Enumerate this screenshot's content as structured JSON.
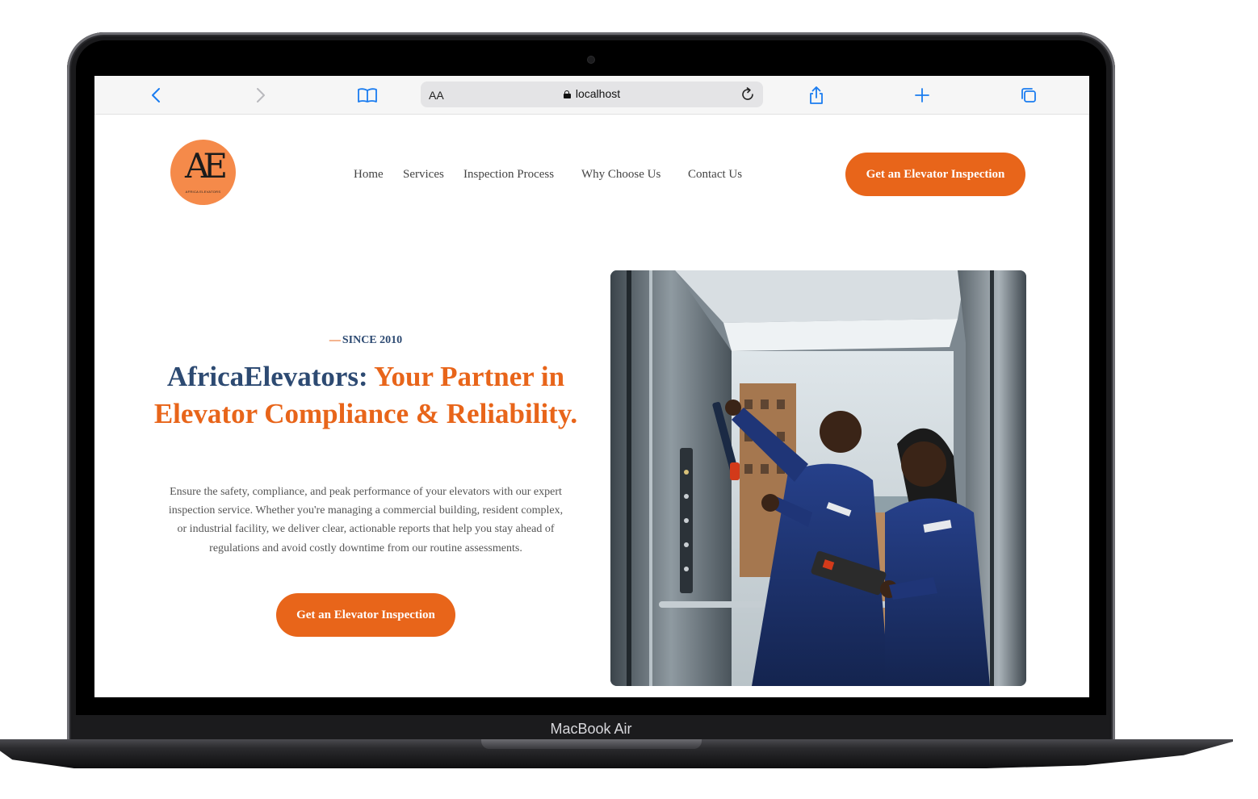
{
  "device": {
    "label": "MacBook Air"
  },
  "browser": {
    "text_size_label": "AA",
    "url": "localhost",
    "icons": [
      "back-icon",
      "forward-icon",
      "book-icon",
      "lock-icon",
      "reload-icon",
      "share-icon",
      "plus-icon",
      "tabs-icon"
    ]
  },
  "site": {
    "logo": {
      "mark": "AE",
      "text": "AFRICA ELEVATORS"
    },
    "nav": [
      "Home",
      "Services",
      "Inspection Process",
      "Why Choose Us",
      "Contact Us"
    ],
    "header_cta": "Get an Elevator Inspection",
    "hero": {
      "eyebrow_dash": "—",
      "eyebrow": "SINCE 2010",
      "title_brand": "AfricaElevators:",
      "title_rest": "Your Partner in Elevator Compliance & Reliability.",
      "description": "Ensure the safety, compliance, and peak performance of your elevators with our expert inspection service. Whether you're managing a commercial building, resident complex, or industrial facility, we deliver clear, actionable reports that help you stay ahead of regulations and avoid costly downtime from our routine assessments.",
      "cta": "Get an Elevator Inspection"
    }
  },
  "colors": {
    "accent": "#e8651a",
    "brand_blue": "#2d4a72",
    "logo_bg": "#f58a4a",
    "safari_blue": "#1a7cf0"
  }
}
